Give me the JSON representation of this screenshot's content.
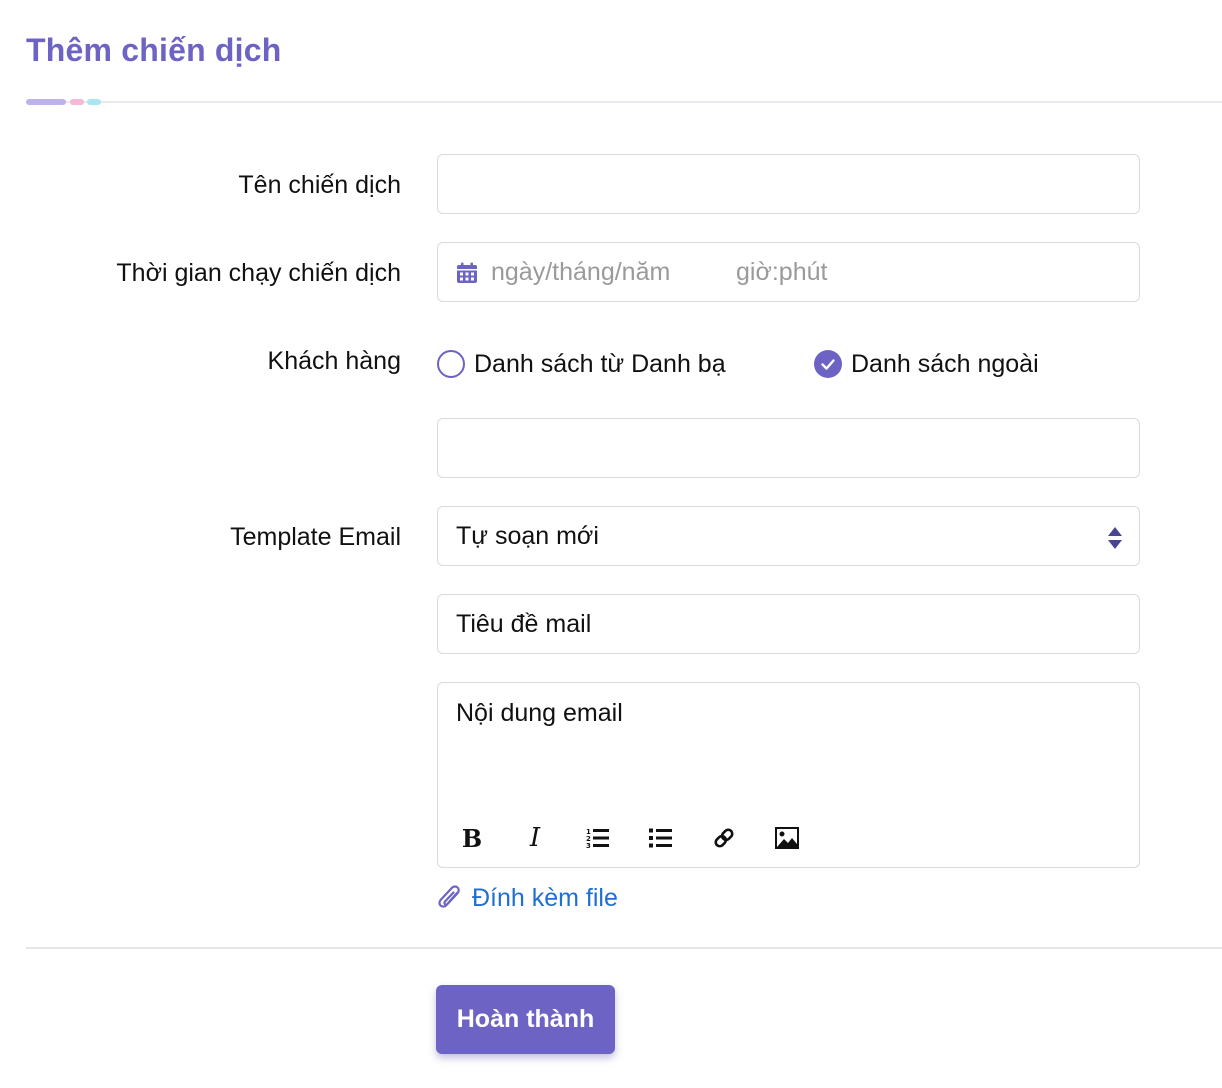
{
  "page": {
    "title": "Thêm chiến dịch"
  },
  "form": {
    "campaign_name": {
      "label": "Tên chiến dịch",
      "value": ""
    },
    "run_time": {
      "label": "Thời gian chạy chiến dịch",
      "date_placeholder": "ngày/tháng/năm",
      "time_placeholder": "giờ:phút",
      "icon": "calendar-icon"
    },
    "customers": {
      "label": "Khách hàng",
      "options": [
        {
          "label": "Danh sách từ Danh bạ",
          "checked": false
        },
        {
          "label": "Danh sách ngoài",
          "checked": true
        }
      ],
      "external_list_value": ""
    },
    "template_email": {
      "label": "Template Email",
      "selected": "Tự soạn mới"
    },
    "mail_subject": {
      "value": "Tiêu đề mail"
    },
    "mail_body": {
      "value": "Nội dung email",
      "toolbar": [
        "bold-icon",
        "italic-icon",
        "ordered-list-icon",
        "unordered-list-icon",
        "link-icon",
        "image-icon"
      ]
    },
    "attach": {
      "label": "Đính kèm file",
      "icon": "paperclip-icon"
    },
    "submit_label": "Hoàn thành"
  },
  "colors": {
    "accent": "#6c63c4",
    "link": "#1f6fd1",
    "border": "#d9d9de",
    "placeholder": "#9a9a9a"
  }
}
